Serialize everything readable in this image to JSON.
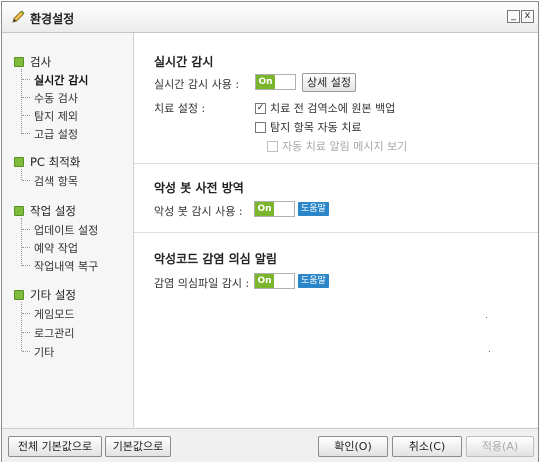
{
  "window": {
    "title": "환경설정",
    "minimize": "_",
    "close": "x"
  },
  "sidebar": {
    "groups": [
      {
        "label": "검사",
        "items": [
          "실시간 감시",
          "수동 검사",
          "탐지 제외",
          "고급 설정"
        ],
        "active": 0
      },
      {
        "label": "PC 최적화",
        "items": [
          "검색 항목"
        ]
      },
      {
        "label": "작업 설정",
        "items": [
          "업데이트 설정",
          "예약 작업",
          "작업내역 복구"
        ]
      },
      {
        "label": "기타 설정",
        "items": [
          "게임모드",
          "로그관리",
          "기타"
        ]
      }
    ]
  },
  "realtime": {
    "title": "실시간 감시",
    "use_label": "실시간 감시 사용 :",
    "toggle": "On",
    "detail_button": "상세 설정",
    "treat_label": "치료 설정 :",
    "options": [
      {
        "label": "치료 전 검역소에 원본 백업",
        "checked": true,
        "disabled": false
      },
      {
        "label": "탐지 항목 자동 치료",
        "checked": false,
        "disabled": false
      },
      {
        "label": "자동 치료 알림 메시지 보기",
        "checked": false,
        "disabled": true
      }
    ]
  },
  "malbot": {
    "title": "악성 봇 사전 방역",
    "use_label": "악성 봇 감시 사용 :",
    "toggle": "On",
    "help": "도움말"
  },
  "suspect": {
    "title": "악성코드 감염 의심 알림",
    "use_label": "감염 의심파일 감시 :",
    "toggle": "On",
    "help": "도움말"
  },
  "footer": {
    "reset_all": "전체 기본값으로",
    "reset": "기본값으로",
    "ok": "확인(O)",
    "cancel": "취소(C)",
    "apply": "적용(A)"
  },
  "colors": {
    "accent_green": "#7ab52c",
    "help_blue": "#2a86c9"
  }
}
